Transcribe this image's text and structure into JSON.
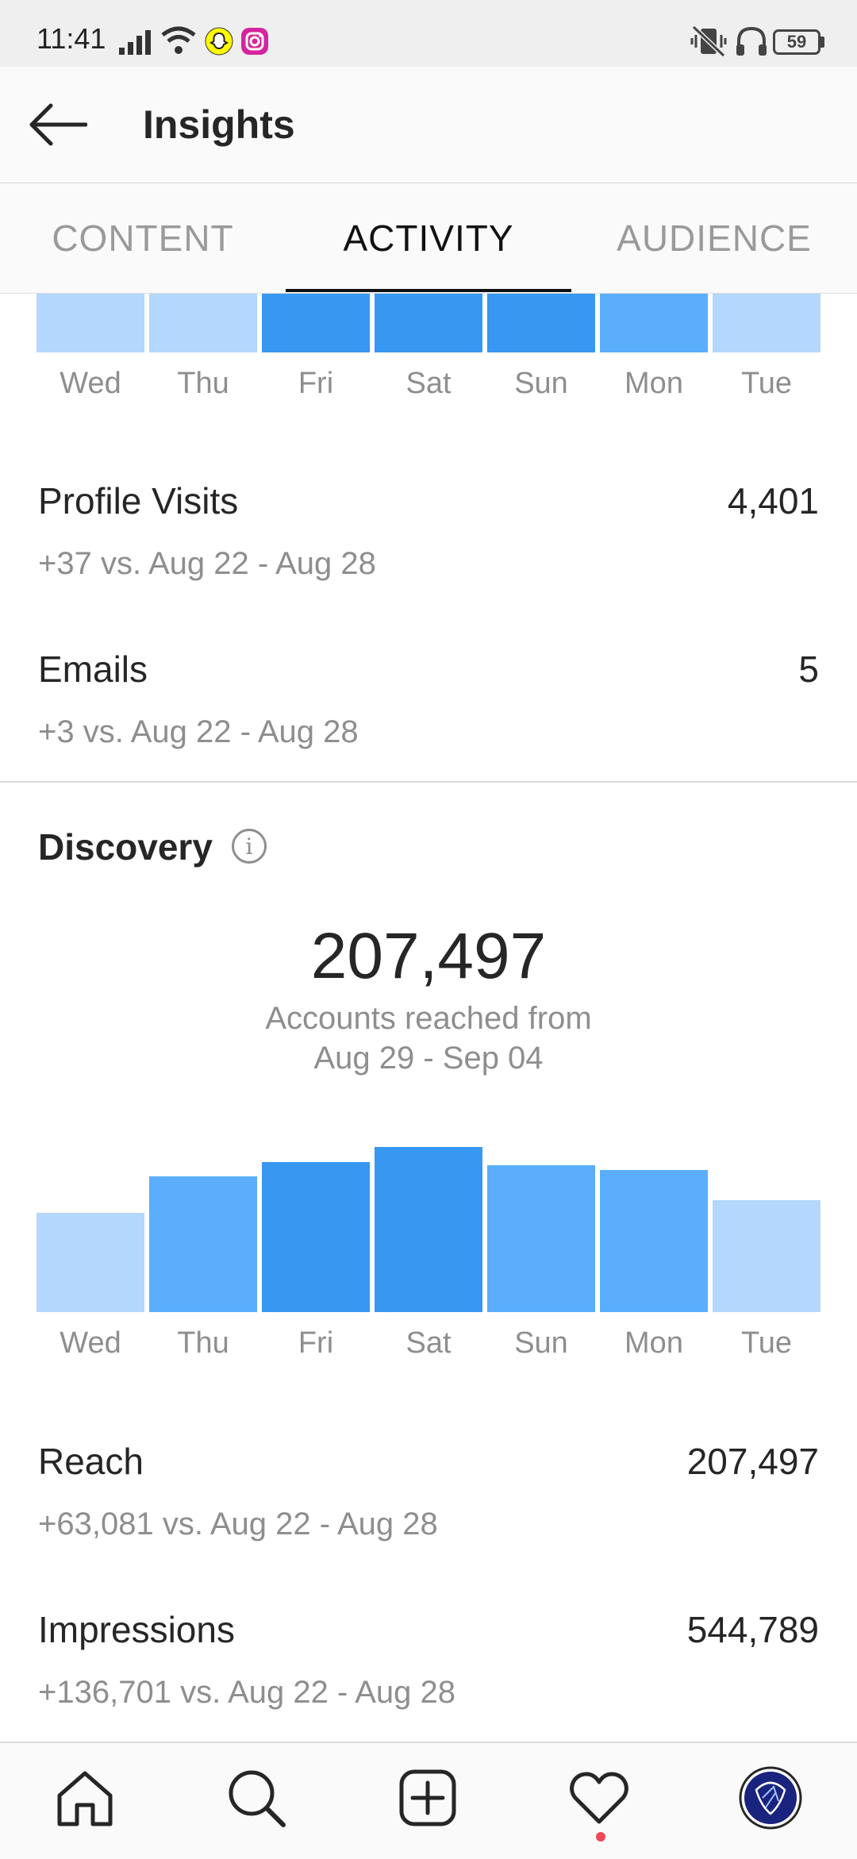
{
  "status_bar": {
    "time": "11:41",
    "battery": "59",
    "icons": [
      "signal-icon",
      "wifi-icon",
      "snapchat-icon",
      "instagram-icon",
      "vibrate-off-icon",
      "headphones-icon",
      "battery-icon"
    ]
  },
  "header": {
    "title": "Insights",
    "back_icon": "back-arrow-icon"
  },
  "tabs": [
    {
      "label": "CONTENT"
    },
    {
      "label": "ACTIVITY"
    },
    {
      "label": "AUDIENCE"
    }
  ],
  "active_tab": "ACTIVITY",
  "colors": {
    "bar_light": "#b3d7fd",
    "bar_medium": "#5aaefc",
    "bar_dark": "#3897f0",
    "notification_dot": "#ed4956"
  },
  "interactions_chart": {
    "days": [
      "Wed",
      "Thu",
      "Fri",
      "Sat",
      "Sun",
      "Mon",
      "Tue"
    ],
    "shades": [
      "light",
      "light",
      "dark",
      "dark",
      "dark",
      "medium",
      "light"
    ]
  },
  "interaction_stats": [
    {
      "label": "Profile Visits",
      "value": "4,401",
      "change": "+37 vs. Aug 22 - Aug 28"
    },
    {
      "label": "Emails",
      "value": "5",
      "change": "+3 vs. Aug 22 - Aug 28"
    }
  ],
  "discovery": {
    "title": "Discovery",
    "info_icon": "info-icon",
    "accounts_reached": "207,497",
    "caption_line1": "Accounts reached from",
    "caption_line2": "Aug 29 - Sep 04"
  },
  "chart_data": {
    "type": "bar",
    "categories": [
      "Wed",
      "Thu",
      "Fri",
      "Sat",
      "Sun",
      "Mon",
      "Tue"
    ],
    "values": [
      0.6,
      0.82,
      0.91,
      1.0,
      0.89,
      0.86,
      0.68
    ],
    "shades": [
      "light",
      "medium",
      "dark",
      "dark",
      "medium",
      "medium",
      "light"
    ],
    "title": "",
    "xlabel": "",
    "ylabel": "",
    "grid": false
  },
  "discovery_stats": [
    {
      "label": "Reach",
      "value": "207,497",
      "change": "+63,081 vs. Aug 22 - Aug 28"
    },
    {
      "label": "Impressions",
      "value": "544,789",
      "change": "+136,701 vs. Aug 22 - Aug 28"
    }
  ],
  "bottom_nav": [
    {
      "name": "home-icon"
    },
    {
      "name": "search-icon"
    },
    {
      "name": "add-post-icon"
    },
    {
      "name": "heart-icon"
    },
    {
      "name": "profile-avatar"
    }
  ]
}
